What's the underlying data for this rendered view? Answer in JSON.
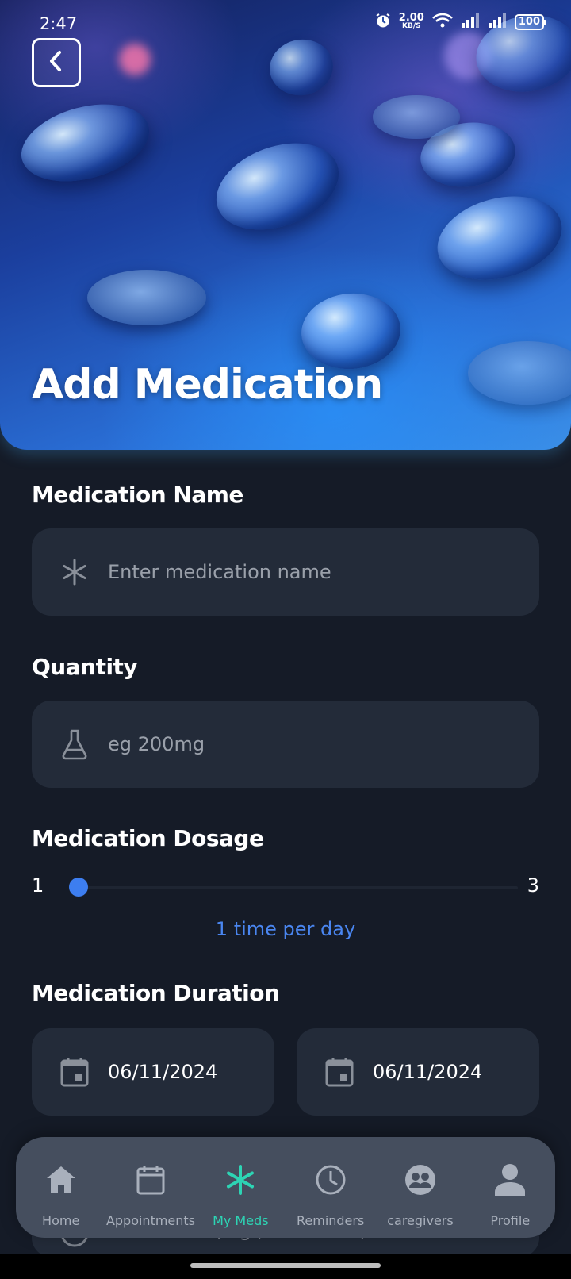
{
  "status_bar": {
    "time": "2:47",
    "net_speed_value": "2.00",
    "net_speed_unit": "KB/S",
    "battery": "100",
    "icons": [
      "alarm-icon",
      "wifi-icon",
      "signal-icon",
      "signal-icon",
      "battery-icon"
    ]
  },
  "header": {
    "title": "Add Medication",
    "back_icon": "chevron-left-icon"
  },
  "form": {
    "name": {
      "label": "Medication Name",
      "placeholder": "Enter medication name",
      "value": "",
      "icon": "asterisk-icon"
    },
    "quantity": {
      "label": "Quantity",
      "placeholder": "eg 200mg",
      "value": "",
      "icon": "flask-icon"
    },
    "dosage": {
      "label": "Medication Dosage",
      "min": "1",
      "max": "3",
      "value": 1,
      "value_text": "1 time per day"
    },
    "duration": {
      "label": "Medication Duration",
      "start_date": "06/11/2024",
      "end_date": "06/11/2024",
      "icon": "calendar-icon"
    },
    "time": {
      "placeholder": "Enter time (e.g., 08:00 AM)",
      "icon": "clock-icon"
    }
  },
  "bottom_nav": {
    "active": "My Meds",
    "active_color": "#2dd4b4",
    "items": [
      {
        "label": "Home",
        "icon": "home-icon"
      },
      {
        "label": "Appointments",
        "icon": "calendar-icon"
      },
      {
        "label": "My Meds",
        "icon": "asterisk-icon"
      },
      {
        "label": "Reminders",
        "icon": "clock-icon"
      },
      {
        "label": "caregivers",
        "icon": "group-icon"
      },
      {
        "label": "Profile",
        "icon": "person-icon"
      }
    ]
  },
  "colors": {
    "background": "#151b27",
    "field": "#232b39",
    "accent_blue": "#3d7ef0",
    "nav_background": "#454e5e"
  }
}
